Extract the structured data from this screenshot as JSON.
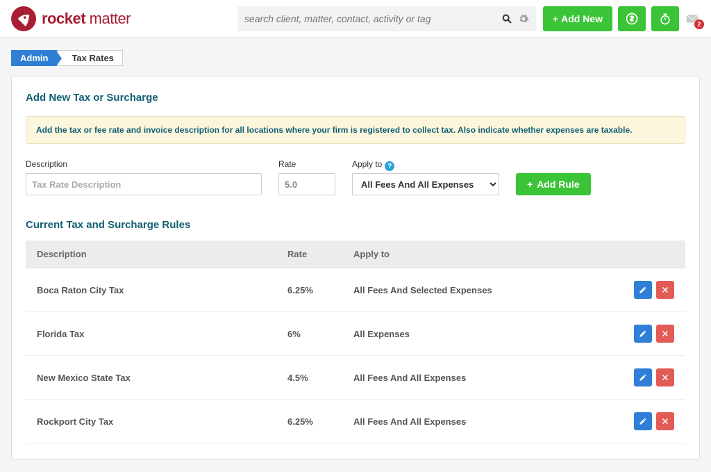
{
  "header": {
    "brand_bold": "rocket",
    "brand_light": " matter",
    "search_placeholder": "search client, matter, contact, activity or tag",
    "add_new_label": "Add New",
    "notification_count": "2"
  },
  "breadcrumb": {
    "admin": "Admin",
    "current": "Tax Rates"
  },
  "form": {
    "section_title": "Add New Tax or Surcharge",
    "help_text": "Add the tax or fee rate and invoice description for all locations where your firm is registered to collect tax. Also indicate whether expenses are taxable.",
    "labels": {
      "description": "Description",
      "rate": "Rate",
      "apply_to": "Apply to"
    },
    "desc_placeholder": "Tax Rate Description",
    "rate_value": "5.0",
    "apply_to_selected": "All Fees And All Expenses",
    "add_rule_label": "Add Rule"
  },
  "table": {
    "title": "Current Tax and Surcharge Rules",
    "headers": {
      "description": "Description",
      "rate": "Rate",
      "apply_to": "Apply to"
    },
    "rows": [
      {
        "description": "Boca Raton City Tax",
        "rate": "6.25%",
        "apply_to": "All Fees And Selected Expenses"
      },
      {
        "description": "Florida Tax",
        "rate": "6%",
        "apply_to": "All Expenses"
      },
      {
        "description": "New Mexico State Tax",
        "rate": "4.5%",
        "apply_to": "All Fees And All Expenses"
      },
      {
        "description": "Rockport City Tax",
        "rate": "6.25%",
        "apply_to": "All Fees And All Expenses"
      }
    ]
  }
}
